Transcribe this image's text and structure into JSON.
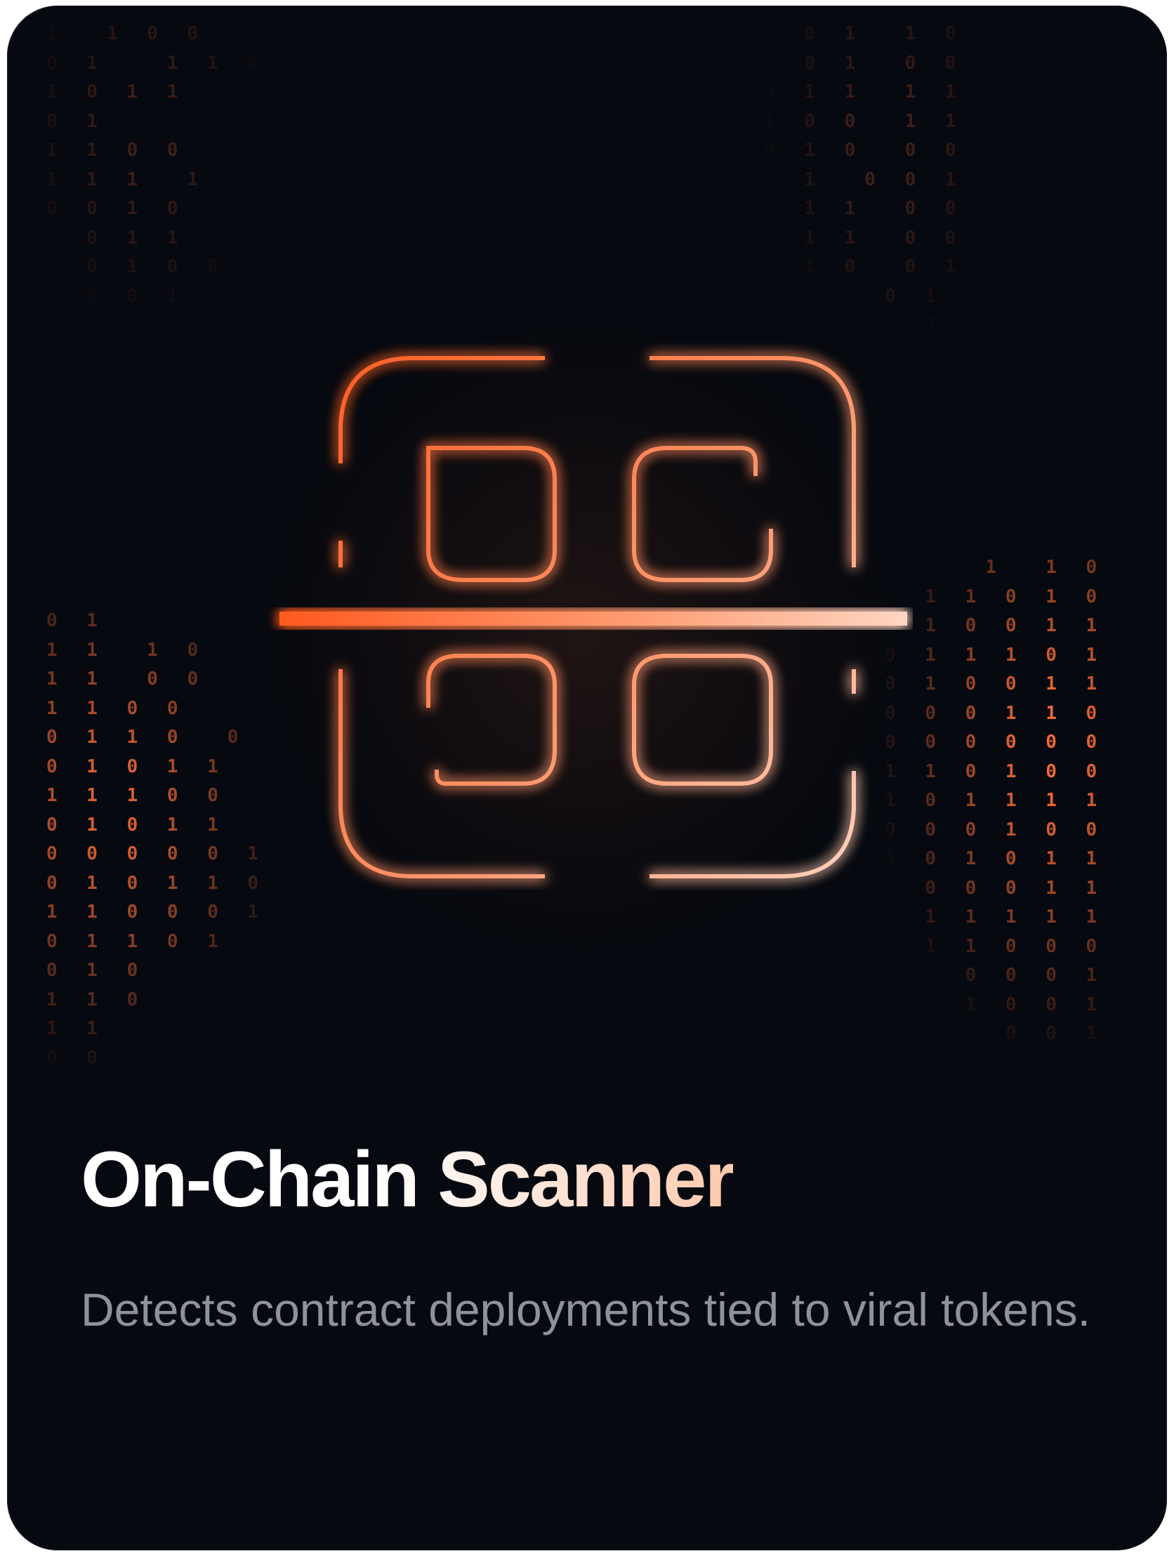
{
  "card": {
    "title": "On-Chain Scanner",
    "description": "Detects contract deployments tied to viral tokens.",
    "icon": "scanner-icon",
    "accent_colors": {
      "start": "#ff5a1f",
      "end": "#ffd5c2",
      "background": "#06090f",
      "description_text": "#8e939b"
    }
  },
  "background_binary": {
    "top_left": [
      "1  1 0 0  1",
      "0 1   1 1 0",
      "1 0 1 1",
      "0 1",
      "1 1 0 0",
      "1 1 1  1",
      "0 0 1 0",
      "  0 1 1",
      "  0 1 0 0",
      "  0 0 1",
      "    1 0"
    ],
    "top_right": [
      "0 0 1  1 0",
      "1 0 1  0 0",
      "0 1 1  1 1",
      "1 0 0  1 1",
      "0 1 0  0 0",
      "  1  0 0 1",
      "0 1 1  0 0",
      "1 1 1  0 0",
      "  1 0  0 1",
      "      0 1 0",
      "        1 1",
      "        0 1"
    ],
    "middle_left": [
      "0 1",
      "1 1  1 0",
      "1 1  0 0",
      "1 1 0 0",
      "0 1 1 0  0",
      "0 1 0 1 1",
      "1 1 1 0 0",
      "0 1 0 1 1",
      "0 0 0 0 0 1",
      "0 1 0 1 1 0",
      "1 1 0 0 0 1",
      "0 1 1 0 1",
      "0 1 0",
      "1 1 0",
      "1 1",
      "0 0",
      "1 0"
    ],
    "middle_right": [
      "     1  1 0",
      "  1 1 0 1 0",
      "  1 0 0 1 1",
      "0 1 1 1 0 1",
      "0 1 0 0 1 1",
      "0 0 0 1 1 0",
      "0 0 0 0 0 0",
      "1 1 0 1 0 0",
      "1 0 1 1 1 1",
      "0 0 0 1 0 0",
      "1 0 1 0 1 1",
      "0 0 0 0 1 1",
      "0 1 1 1 1 1",
      "0 1 1 0 0 0",
      "  1 0 0 0 1",
      "  1 1 0 0 1",
      "    1 0 0 1",
      "      1 0 1",
      "        1 1"
    ]
  }
}
